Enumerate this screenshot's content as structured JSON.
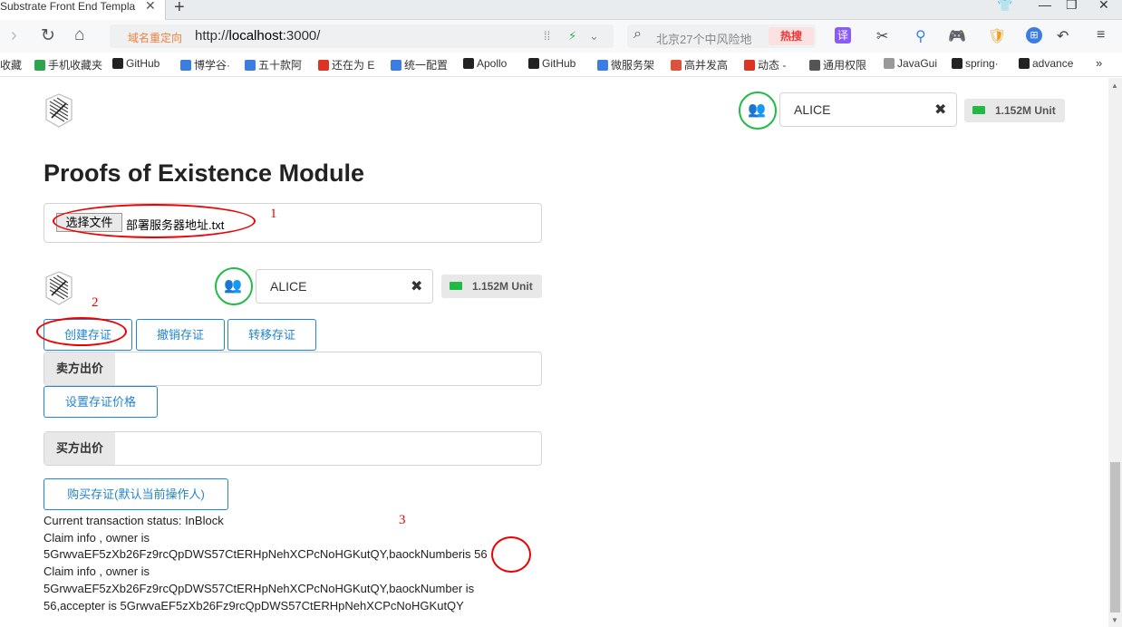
{
  "browser": {
    "tab_title": "Substrate Front End Templa",
    "redirect_label": "域名重定向",
    "url_prefix": "http://",
    "url_host": "localhost",
    "url_rest": ":3000/",
    "search_placeholder": "北京27个中风险地",
    "hot_label": "热搜"
  },
  "bookmarks": [
    {
      "label": "收藏",
      "color": "#f0b400"
    },
    {
      "label": "手机收藏夹",
      "color": "#2ea44f"
    },
    {
      "label": "GitHub",
      "color": "#222222"
    },
    {
      "label": "博学谷·",
      "color": "#3b7de0"
    },
    {
      "label": "五十款阿",
      "color": "#3b7de0"
    },
    {
      "label": "还在为 E",
      "color": "#d32"
    },
    {
      "label": "统一配置",
      "color": "#3b7de0"
    },
    {
      "label": "Apollo",
      "color": "#222222"
    },
    {
      "label": "GitHub",
      "color": "#222222"
    },
    {
      "label": "微服务架",
      "color": "#3b7de0"
    },
    {
      "label": "高并发高",
      "color": "#d9543a"
    },
    {
      "label": "动态 -",
      "color": "#d32"
    },
    {
      "label": "通用权限",
      "color": "#555555"
    },
    {
      "label": "JavaGui",
      "color": "#999999"
    },
    {
      "label": "spring·",
      "color": "#222222"
    },
    {
      "label": "advance",
      "color": "#222222"
    }
  ],
  "header": {
    "account_name": "ALICE",
    "balance": "1.152M Unit"
  },
  "module": {
    "title": "Proofs of Existence Module",
    "file_button": "选择文件",
    "file_name": "部署服务器地址.txt",
    "account_name": "ALICE",
    "balance": "1.152M Unit",
    "btn_create": "创建存证",
    "btn_revoke": "撤销存证",
    "btn_transfer": "转移存证",
    "seller_label": "卖方出价",
    "btn_set_price": "设置存证价格",
    "buyer_label": "买方出价",
    "btn_buy": "购买存证(默认当前操作人)"
  },
  "status": {
    "line1": "Current transaction status: InBlock",
    "line2": "Claim info , owner is",
    "line3a": "5GrwvaEF5zXb26Fz9rcQpDWS57CtERHpNehXCPcNoHGKutQY,baockNumber",
    "line3b": "is",
    "line3c": "56",
    "line4": "Claim info , owner is",
    "line5": "5GrwvaEF5zXb26Fz9rcQpDWS57CtERHpNehXCPcNoHGKutQY,baockNumber is",
    "line6": "56,accepter is 5GrwvaEF5zXb26Fz9rcQpDWS57CtERHpNehXCPcNoHGKutQY"
  },
  "annotations": {
    "a1": "1",
    "a2": "2",
    "a3": "3",
    "color": "#e00000"
  }
}
